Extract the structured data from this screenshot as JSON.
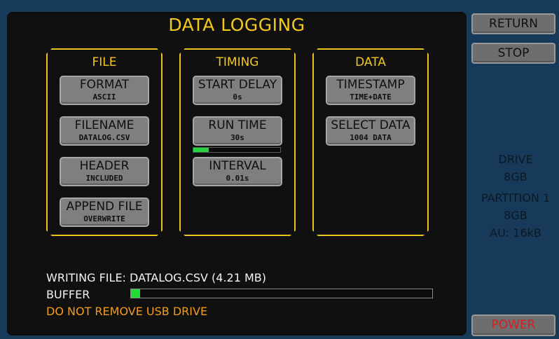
{
  "title": "DATA LOGGING",
  "panels": {
    "file": {
      "title": "FILE",
      "buttons": [
        {
          "label": "FORMAT",
          "value": "ASCII"
        },
        {
          "label": "FILENAME",
          "value": "DATALOG.CSV"
        },
        {
          "label": "HEADER",
          "value": "INCLUDED"
        },
        {
          "label": "APPEND FILE",
          "value": "OVERWRITE"
        }
      ]
    },
    "timing": {
      "title": "TIMING",
      "buttons": [
        {
          "label": "START DELAY",
          "value": "0s"
        },
        {
          "label": "RUN TIME",
          "value": "30s"
        },
        {
          "label": "INTERVAL",
          "value": "0.01s"
        }
      ],
      "run_time_progress_percent": 18
    },
    "data": {
      "title": "DATA",
      "buttons": [
        {
          "label": "TIMESTAMP",
          "value": "TIME+DATE"
        },
        {
          "label": "SELECT DATA",
          "value": "1004 DATA"
        }
      ]
    }
  },
  "status": {
    "writing": "WRITING FILE: DATALOG.CSV (4.21 MB)",
    "buffer_label": "BUFFER",
    "buffer_percent": 3,
    "warning": "DO NOT REMOVE USB DRIVE"
  },
  "sidebar": {
    "return_label": "RETURN",
    "stop_label": "STOP",
    "power_label": "POWER",
    "drive": {
      "drive_label": "DRIVE",
      "drive_size": "8GB",
      "partition_label": "PARTITION 1",
      "partition_size": "8GB",
      "au": "AU: 16kB"
    }
  },
  "colors": {
    "accent": "#f3c81e",
    "warning": "#f39d1a",
    "progress": "#21dd33",
    "power": "#d51f1f"
  }
}
